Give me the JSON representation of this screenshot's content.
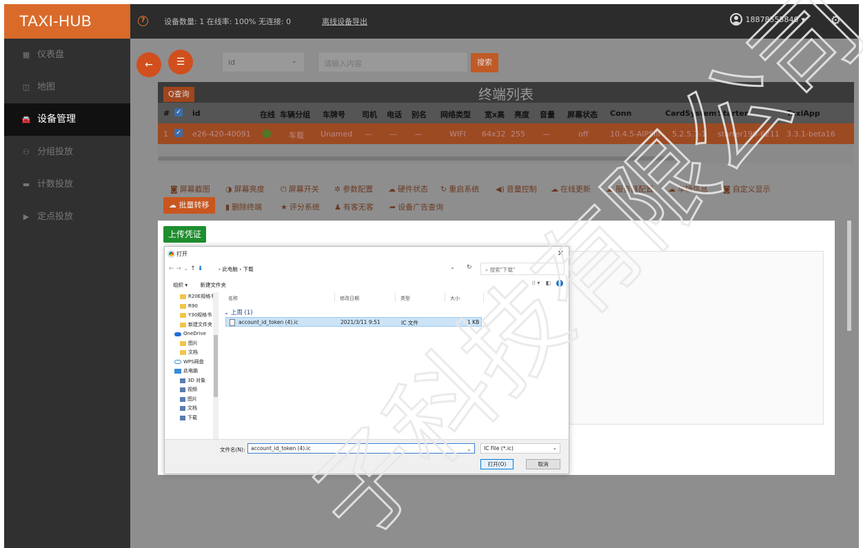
{
  "topbar": {
    "brand": "TAXI-HUB",
    "device_stats": "设备数量: 1  在线率: 100%  无连接: 0",
    "export_link": "离线设备导出",
    "user": "18878555840",
    "user_caret": "▾"
  },
  "sidebar": {
    "items": [
      {
        "label": "仪表盘",
        "icon": "dashboard-icon",
        "glyph": "▦"
      },
      {
        "label": "地图",
        "icon": "map-icon",
        "glyph": "◫"
      },
      {
        "label": "设备管理",
        "icon": "car-icon",
        "glyph": "🚘"
      },
      {
        "label": "分组投放",
        "icon": "group-icon",
        "glyph": "⚇"
      },
      {
        "label": "计数投放",
        "icon": "monitor-icon",
        "glyph": "▬"
      },
      {
        "label": "定点投放",
        "icon": "play-icon",
        "glyph": "▶"
      }
    ]
  },
  "search": {
    "field_value": "id",
    "placeholder": "请输入内容",
    "button": "搜索"
  },
  "table": {
    "query_button": "Q查询",
    "title": "终端列表",
    "headers": [
      "#",
      "id",
      "在线",
      "车辆分组",
      "车牌号",
      "司机",
      "电话",
      "别名",
      "网络类型",
      "宽x高",
      "亮度",
      "音量",
      "屏幕状态",
      "Conn",
      "CardSystem",
      "Starter",
      "TaxiApp"
    ],
    "row": [
      "1",
      "e26-420-40091",
      "",
      "车载",
      "Unamed",
      "—",
      "—",
      "—",
      "WIFI",
      "64x32",
      "255",
      "—",
      "off",
      "10.4.5-AIPSIII",
      "5.2.5.7-1",
      "starter190-6211",
      "3.3.1-beta16"
    ]
  },
  "toolbar": {
    "row1": [
      "屏幕截图",
      "屏幕亮度",
      "屏幕开关",
      "参数配置",
      "硬件状态",
      "重启系统",
      "音量控制",
      "在线更新",
      "服务器配置",
      "车辆信息",
      "自定义显示"
    ],
    "row2": [
      "删除终端",
      "评分系统",
      "有客无客",
      "设备广告查询"
    ],
    "batch_button": "批量转移"
  },
  "upload": {
    "button": "上传凭证"
  },
  "dialog": {
    "title": "打开",
    "breadcrumb": "此电脑  ›  下载",
    "search_placeholder": "搜索\"下载\"",
    "organize": "组织 ▾",
    "new_folder": "新建文件夹",
    "nav_items": [
      {
        "label": "R20E规格书",
        "type": "folder",
        "sub": true
      },
      {
        "label": "R90",
        "type": "folder",
        "sub": true
      },
      {
        "label": "Y30规格书",
        "type": "folder",
        "sub": true
      },
      {
        "label": "新建文件夹",
        "type": "folder",
        "sub": true
      },
      {
        "label": "OneDrive",
        "type": "cloud",
        "sub": false
      },
      {
        "label": "图片",
        "type": "folder",
        "sub": true
      },
      {
        "label": "文档",
        "type": "folder",
        "sub": true
      },
      {
        "label": "WPS网盘",
        "type": "wps",
        "sub": false
      },
      {
        "label": "此电脑",
        "type": "pc",
        "sub": false
      },
      {
        "label": "3D 对象",
        "type": "sub",
        "sub": true
      },
      {
        "label": "视频",
        "type": "sub",
        "sub": true
      },
      {
        "label": "图片",
        "type": "sub",
        "sub": true
      },
      {
        "label": "文档",
        "type": "sub",
        "sub": true
      },
      {
        "label": "下载",
        "type": "sub",
        "sub": true
      }
    ],
    "columns": [
      "名称",
      "修改日期",
      "类型",
      "大小"
    ],
    "group": "上周 (1)",
    "file": {
      "name": "account_id_token (4).ic",
      "date": "2021/3/11 9:51",
      "type": "IC 文件",
      "size": "1 KB"
    },
    "filename_label": "文件名(N):",
    "filename_value": "account_id_token (4).ic",
    "filetype": "IC File (*.ic)",
    "open_button": "打开(O)",
    "cancel_button": "取消"
  },
  "watermark": "子科技有限公司",
  "colors": {
    "brand": "#d96a2a",
    "accent_button": "#d04f1c",
    "upload_button": "#1e8e2e"
  }
}
